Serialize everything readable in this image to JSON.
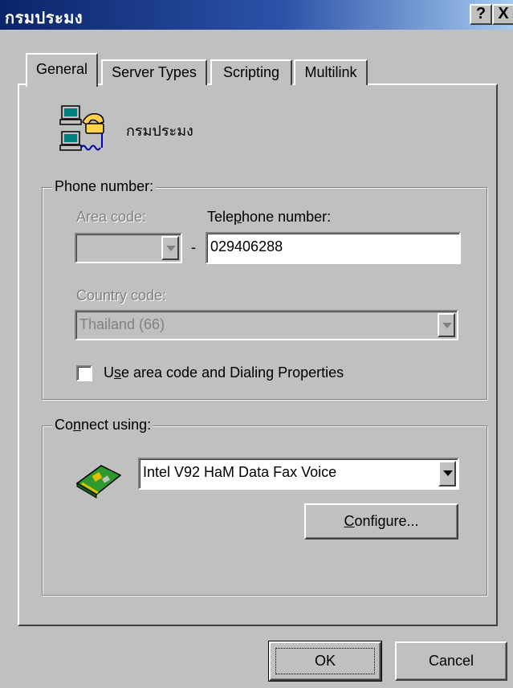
{
  "window": {
    "title": "กรมประมง",
    "help_label": "?",
    "close_label": "X"
  },
  "tabs": [
    {
      "label": "General",
      "active": true
    },
    {
      "label": "Server Types",
      "active": false
    },
    {
      "label": "Scripting",
      "active": false
    },
    {
      "label": "Multilink",
      "active": false
    }
  ],
  "connection": {
    "name": "กรมประมง",
    "icon": "dialup-connection-icon"
  },
  "phone": {
    "group_label": "Phone number:",
    "area_code_label": "Area code:",
    "area_code_value": "",
    "dash": "-",
    "telephone_label_pre": "Tele",
    "telephone_label_hot": "p",
    "telephone_label_post": "hone number:",
    "telephone_value": "029406288",
    "country_code_label": "Country code:",
    "country_code_value": "Thailand (66)",
    "use_area_pre": "U",
    "use_area_hot": "s",
    "use_area_post": "e area code and Dialing Properties",
    "use_area_checked": false
  },
  "connect": {
    "group_label_pre": "Co",
    "group_label_hot": "n",
    "group_label_post": "nect using:",
    "modem_value": "Intel V92 HaM Data Fax Voice",
    "modem_icon": "modem-card-icon",
    "configure_hot": "C",
    "configure_post": "onfigure..."
  },
  "footer": {
    "ok_label": "OK",
    "cancel_label": "Cancel"
  },
  "colors": {
    "title_start": "#0a246a",
    "title_end": "#a6caf0",
    "face": "#c0c0c0"
  }
}
